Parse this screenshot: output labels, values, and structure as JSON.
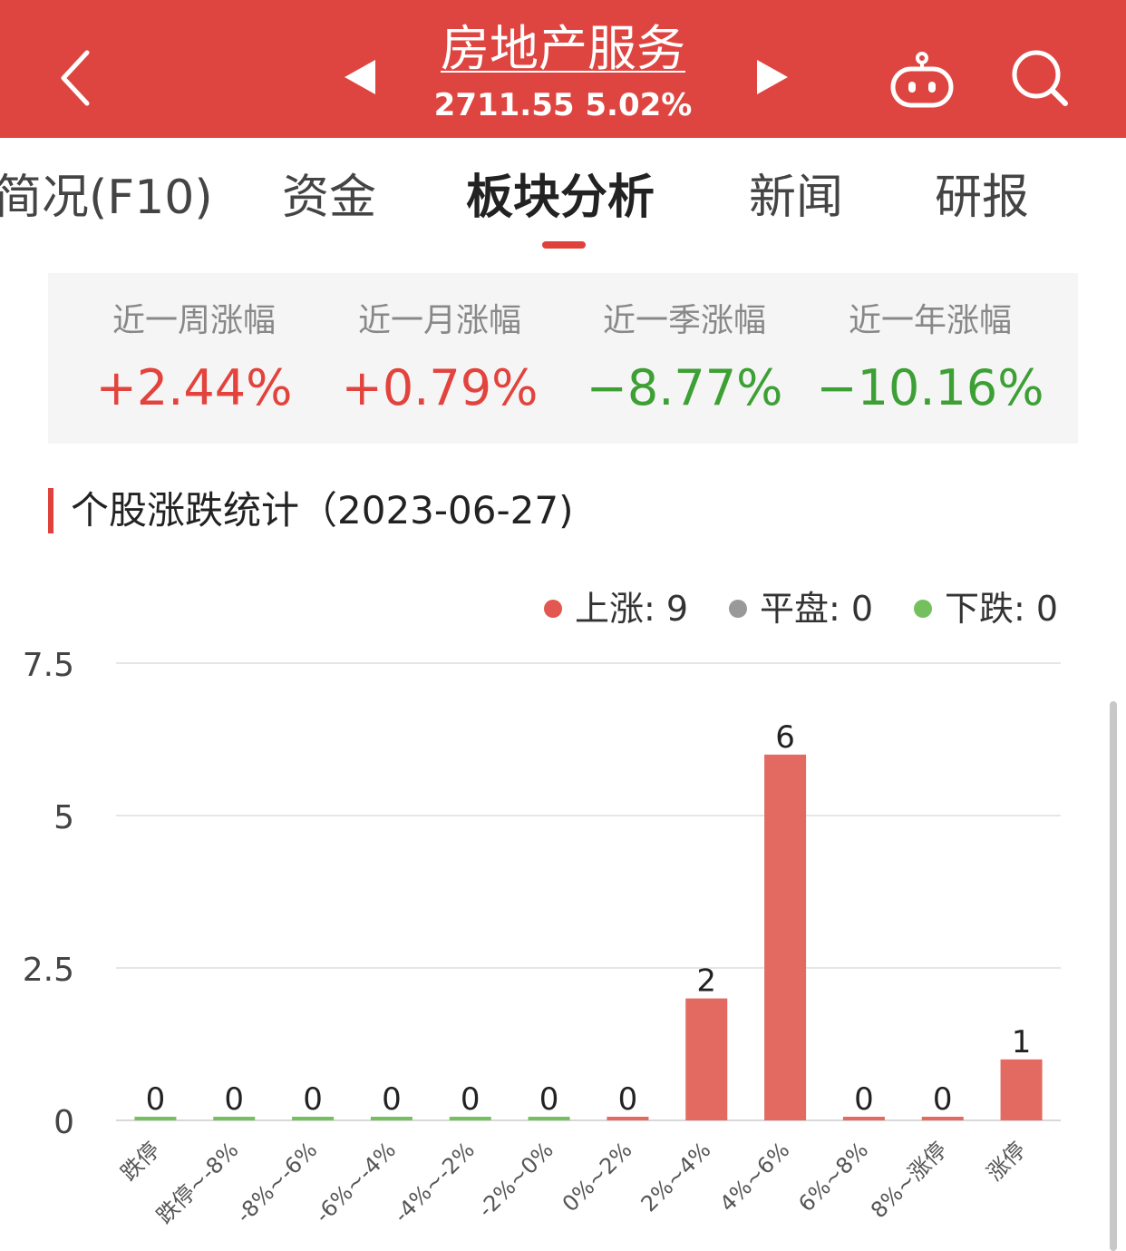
{
  "header": {
    "title": "房地产服务",
    "subtitle": "2711.55 5.02%",
    "bg_color": "#df4540",
    "icons": [
      "back-arrow-icon",
      "prev-triangle-icon",
      "next-triangle-icon",
      "robot-icon",
      "search-icon"
    ]
  },
  "tabs": [
    {
      "label": "简况(F10)"
    },
    {
      "label": "资金"
    },
    {
      "label": "板块分析",
      "active": true
    },
    {
      "label": "新闻"
    },
    {
      "label": "研报"
    }
  ],
  "stats": [
    {
      "label": "近一周涨幅",
      "value": "+2.44%",
      "trend": "up"
    },
    {
      "label": "近一月涨幅",
      "value": "+0.79%",
      "trend": "up"
    },
    {
      "label": "近一季涨幅",
      "value": "−8.77%",
      "trend": "down"
    },
    {
      "label": "近一年涨幅",
      "value": "−10.16%",
      "trend": "down"
    }
  ],
  "section": {
    "title": "个股涨跌统计（2023-06-27)"
  },
  "legend": [
    {
      "label": "上涨: 9",
      "color": "#e2574f"
    },
    {
      "label": "平盘: 0",
      "color": "#999999"
    },
    {
      "label": "下跌: 0",
      "color": "#75c05e"
    }
  ],
  "chart_data": {
    "type": "bar",
    "categories": [
      "跌停",
      "跌停~-8%",
      "-8%~-6%",
      "-6%~-4%",
      "-4%~-2%",
      "-2%~0%",
      "0%~2%",
      "2%~4%",
      "4%~6%",
      "6%~8%",
      "8%~涨停",
      "涨停"
    ],
    "values": [
      0,
      0,
      0,
      0,
      0,
      0,
      0,
      2,
      6,
      0,
      0,
      1
    ],
    "bar_colors": [
      "#75c05e",
      "#75c05e",
      "#75c05e",
      "#75c05e",
      "#75c05e",
      "#75c05e",
      "#e26a61",
      "#e26a61",
      "#e26a61",
      "#e26a61",
      "#e26a61",
      "#e26a61"
    ],
    "yticks": [
      "0",
      "2.5",
      "5",
      "7.5"
    ],
    "ylim": [
      0,
      7.5
    ],
    "title": "",
    "xlabel": "",
    "ylabel": "",
    "grid": true
  }
}
